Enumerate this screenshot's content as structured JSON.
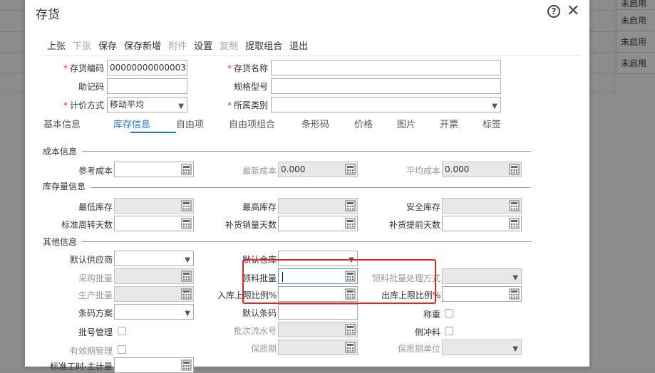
{
  "background": {
    "status_cells": [
      "未启用",
      "未启用",
      "未启用",
      "未启用"
    ]
  },
  "dialog": {
    "title": "存货",
    "help_icon": "?",
    "close_icon": "✕"
  },
  "toolbar": [
    {
      "label": "上张",
      "disabled": false
    },
    {
      "label": "下张",
      "disabled": true
    },
    {
      "label": "保存",
      "disabled": false
    },
    {
      "label": "保存新增",
      "disabled": false
    },
    {
      "label": "附件",
      "disabled": true
    },
    {
      "label": "设置",
      "disabled": false
    },
    {
      "label": "复制",
      "disabled": true
    },
    {
      "label": "提取组合",
      "disabled": false
    },
    {
      "label": "退出",
      "disabled": false
    }
  ],
  "header_fields": {
    "code_label": "存货编码",
    "code_value": "00000000000003",
    "name_label": "存货名称",
    "name_value": "",
    "mnemonic_label": "助记码",
    "spec_label": "规格型号",
    "pricing_label": "计价方式",
    "pricing_value": "移动平均",
    "category_label": "所属类别",
    "category_value": ""
  },
  "tabs": [
    "基本信息",
    "库存信息",
    "自由项",
    "自由项组合",
    "条形码",
    "价格",
    "图片",
    "开票",
    "标签"
  ],
  "active_tab": "库存信息",
  "sections": {
    "cost": "成本信息",
    "stock": "库存量信息",
    "other": "其他信息"
  },
  "cost": {
    "ref_cost_label": "参考成本",
    "latest_cost_label": "最新成本",
    "latest_cost_value": "0.000",
    "avg_cost_label": "平均成本",
    "avg_cost_value": "0.000"
  },
  "stock": {
    "min_label": "最低库存",
    "max_label": "最高库存",
    "safe_label": "安全库存",
    "turnover_label": "标准周转天数",
    "replenish_sales_label": "补货销量天数",
    "replenish_lead_label": "补货提前天数"
  },
  "other": {
    "default_supplier_label": "默认供应商",
    "default_warehouse_label": "默认仓库",
    "purchase_batch_label": "采购批量",
    "issue_batch_label": "领料批量",
    "issue_batch_mode_label": "领料批量处理方式",
    "production_batch_label": "生产批量",
    "in_upper_ratio_label": "入库上限比例%",
    "out_upper_ratio_label": "出库上限比例%",
    "barcode_scheme_label": "条码方案",
    "default_barcode_label": "默认条码",
    "weigh_label": "称重",
    "batch_mgmt_label": "批号管理",
    "batch_serial_label": "批次流水号",
    "backflush_label": "倒冲料",
    "expiry_mgmt_label": "有效期管理",
    "shelf_life_label": "保质期",
    "shelf_life_unit_label": "保质期单位",
    "std_hours_label": "标准工时·主计量"
  }
}
